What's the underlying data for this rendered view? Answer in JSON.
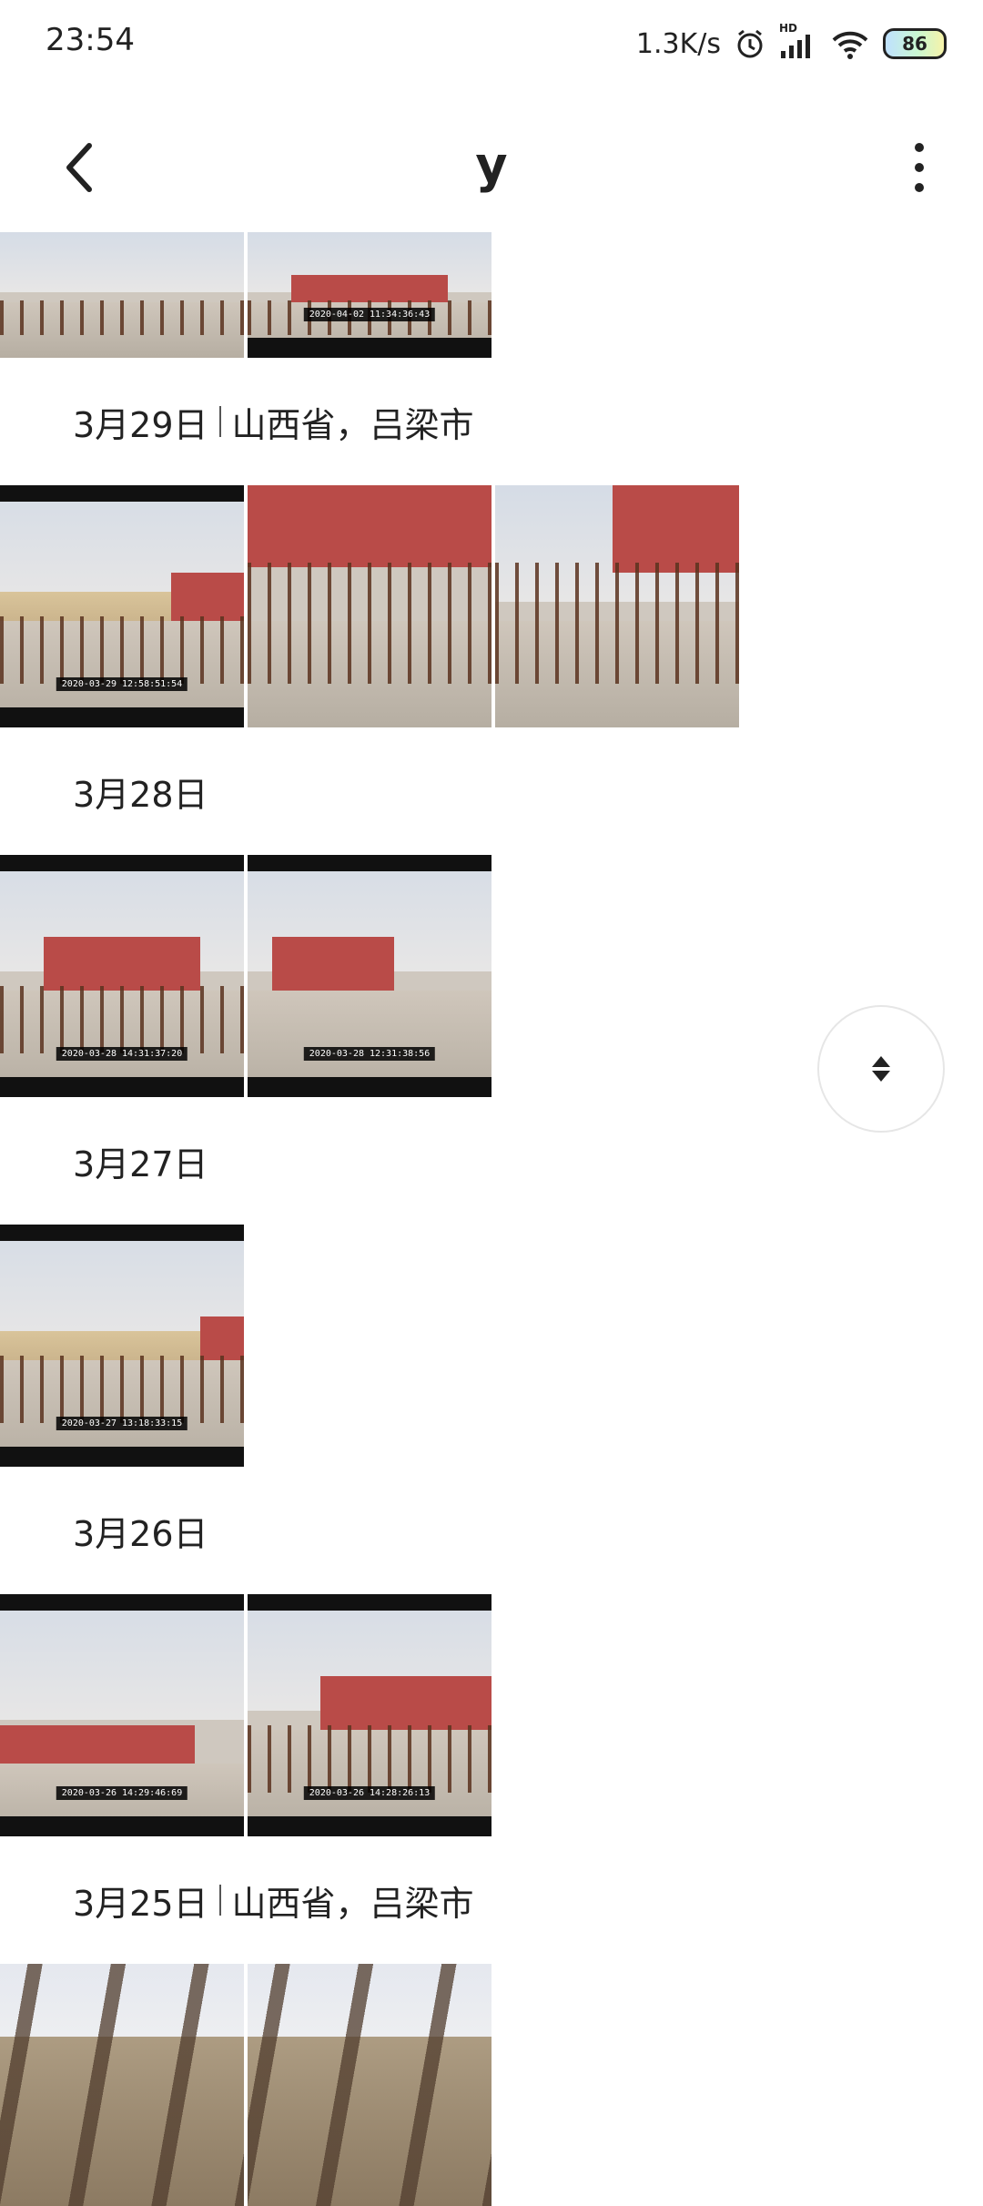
{
  "status_bar": {
    "time": "23:54",
    "network_speed": "1.3K/s",
    "hd_label": "HD",
    "battery": "86",
    "icons": [
      "alarm-icon",
      "signal-icon",
      "wifi-icon",
      "battery-icon"
    ]
  },
  "app_bar": {
    "title": "y",
    "back_icon": "chevron-left-icon",
    "more_icon": "more-vertical-icon"
  },
  "sections": [
    {
      "date": "",
      "location": "",
      "photos": [
        {
          "stamp": ""
        },
        {
          "stamp": "2020-04-02 11:34:36:43"
        }
      ]
    },
    {
      "date": "3月29日",
      "location": "山西省，吕梁市",
      "photos": [
        {
          "stamp": "2020-03-29 12:58:51:54"
        },
        {
          "stamp": ""
        },
        {
          "stamp": ""
        }
      ]
    },
    {
      "date": "3月28日",
      "location": "",
      "photos": [
        {
          "stamp": "2020-03-28 14:31:37:20"
        },
        {
          "stamp": "2020-03-28 12:31:38:56"
        }
      ]
    },
    {
      "date": "3月27日",
      "location": "",
      "photos": [
        {
          "stamp": "2020-03-27 13:18:33:15"
        }
      ]
    },
    {
      "date": "3月26日",
      "location": "",
      "photos": [
        {
          "stamp": "2020-03-26 14:29:46:69"
        },
        {
          "stamp": "2020-03-26 14:28:26:13"
        }
      ]
    },
    {
      "date": "3月25日",
      "location": "山西省，吕梁市",
      "photos": [
        {
          "stamp": ""
        },
        {
          "stamp": ""
        }
      ]
    }
  ],
  "fast_scroll_icon": "fast-scroll-icon",
  "colors": {
    "background": "#ffffff",
    "text": "#222222"
  }
}
